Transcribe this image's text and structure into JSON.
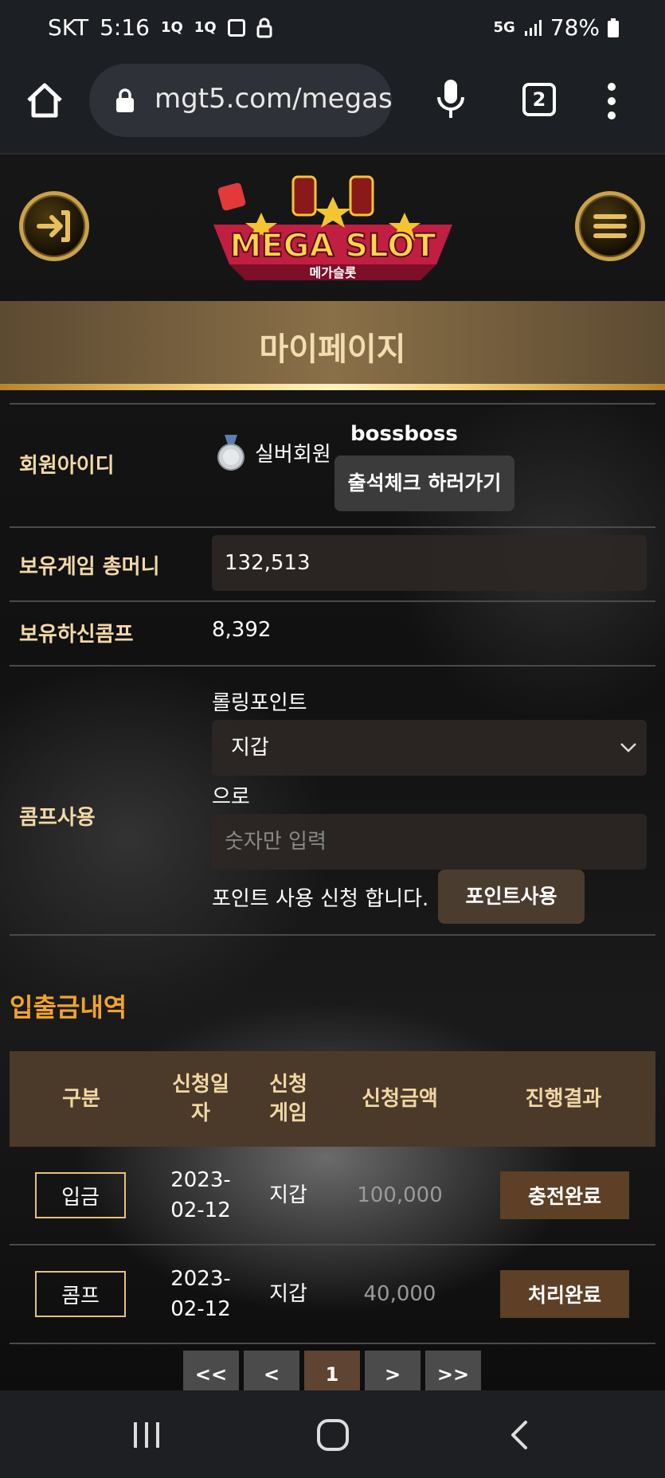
{
  "status_bar": {
    "carrier": "SKT",
    "time": "5:16",
    "network": "5G",
    "battery": "78%"
  },
  "browser": {
    "url": "mgt5.com/megas",
    "tab_count": "2"
  },
  "header": {
    "logo_text": "MEGA SLOT",
    "logo_subtext": "메가슬롯"
  },
  "page_title": "마이페이지",
  "member": {
    "id_label": "회원아이디",
    "grade": "실버회원",
    "username": "bossboss",
    "attendance_button": "출석체크 하러가기"
  },
  "money": {
    "label": "보유게임 총머니",
    "value": "132,513"
  },
  "comp": {
    "label": "보유하신콤프",
    "value": "8,392"
  },
  "comp_use": {
    "label": "콤프사용",
    "rolling_label": "롤링포인트",
    "select_value": "지갑",
    "to_text": "으로",
    "amount_placeholder": "숫자만 입력",
    "apply_text": "포인트 사용 신청 합니다.",
    "submit_button": "포인트사용"
  },
  "history": {
    "title": "입출금내역",
    "columns": [
      "구분",
      "신청일\n자",
      "신청\n게임",
      "신청금액",
      "진행결과"
    ],
    "rows": [
      {
        "type": "입금",
        "date": "2023-\n02-12",
        "game": "지갑",
        "amount": "100,000",
        "result": "충전완료"
      },
      {
        "type": "콤프",
        "date": "2023-\n02-12",
        "game": "지갑",
        "amount": "40,000",
        "result": "처리완료"
      }
    ]
  },
  "pagination": {
    "first": "<<",
    "prev": "<",
    "current": "1",
    "next": ">",
    "last": ">>"
  }
}
